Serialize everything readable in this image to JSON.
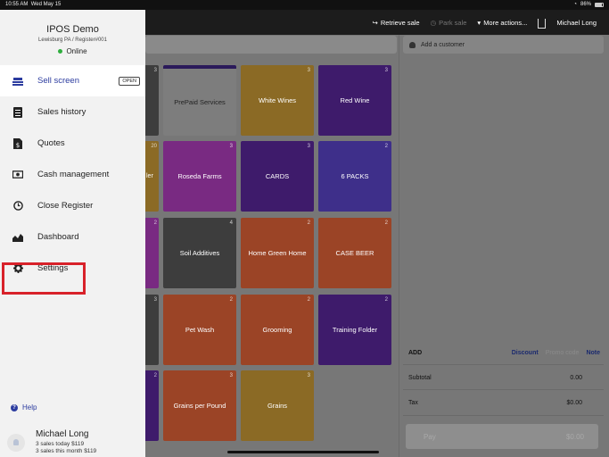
{
  "statusbar": {
    "time": "10:55 AM",
    "date": "Wed May 15",
    "battery": "86%"
  },
  "topbar": {
    "retrieve": "Retrieve sale",
    "park": "Park sale",
    "more": "More actions...",
    "user": "Michael Long"
  },
  "drawer": {
    "store": "IPOS Demo",
    "register": "Lewisburg PA / Register#001",
    "status": "Online",
    "open_badge": "OPEN",
    "items": [
      {
        "label": "Sell screen",
        "icon": "register-icon"
      },
      {
        "label": "Sales history",
        "icon": "list-icon"
      },
      {
        "label": "Quotes",
        "icon": "document-dollar-icon"
      },
      {
        "label": "Cash management",
        "icon": "cash-icon"
      },
      {
        "label": "Close Register",
        "icon": "clock-icon"
      },
      {
        "label": "Dashboard",
        "icon": "chart-icon"
      },
      {
        "label": "Settings",
        "icon": "gear-icon"
      }
    ],
    "help": "Help",
    "user_name": "Michael Long",
    "user_today": "3 sales today $119",
    "user_month": "3 sales this month $119"
  },
  "sale": {
    "add_customer": "Add a customer",
    "add": "ADD",
    "discount": "Discount",
    "promo": "Promo code",
    "note": "Note",
    "subtotal_label": "Subtotal",
    "subtotal": "0.00",
    "tax_label": "Tax",
    "tax": "$0.00",
    "pay_label": "Pay",
    "pay_amount": "$0.00"
  },
  "tiles": {
    "prepaid": {
      "label": "PrePaid Services",
      "count": ""
    },
    "white_wines": {
      "label": "White Wines",
      "count": "3"
    },
    "red_wine": {
      "label": "Red Wine",
      "count": "3"
    },
    "roseda": {
      "label": "Roseda Farms",
      "count": "3"
    },
    "cards": {
      "label": "CARDS",
      "count": "3"
    },
    "six_packs": {
      "label": "6 PACKS",
      "count": "2"
    },
    "soil": {
      "label": "Soil Additives",
      "count": "4"
    },
    "home_green": {
      "label": "Home Green Home",
      "count": "2"
    },
    "case_beer": {
      "label": "CASE BEER",
      "count": "2"
    },
    "pet_wash": {
      "label": "Pet Wash",
      "count": "2"
    },
    "grooming": {
      "label": "Grooming",
      "count": "2"
    },
    "training": {
      "label": "Training Folder",
      "count": "2"
    },
    "grains_lb": {
      "label": "Grains per Pound",
      "count": "3"
    },
    "grains": {
      "label": "Grains",
      "count": "3"
    }
  },
  "partial_tiles": {
    "c1": "3",
    "c2": "20",
    "c2_text": "ler",
    "c3": "2",
    "c4": "3",
    "c5": "2"
  }
}
